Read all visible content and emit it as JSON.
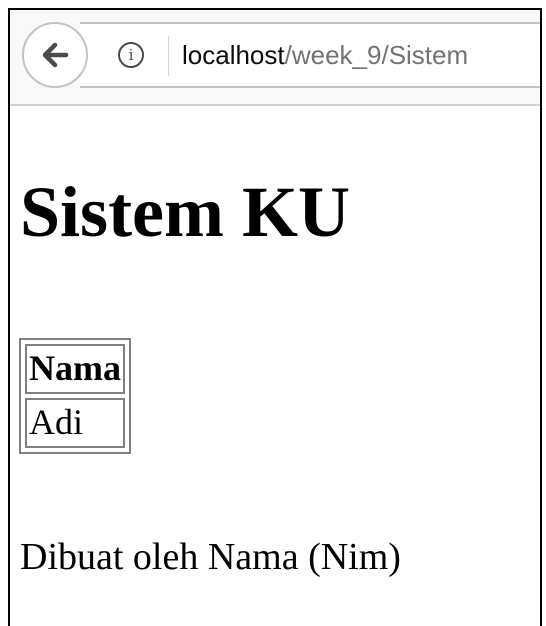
{
  "browser": {
    "back_icon": "arrow-left-icon",
    "info_icon": "info-circle-icon",
    "info_glyph": "i",
    "url_host": "localhost",
    "url_path": "/week_9/Sistem"
  },
  "page": {
    "title": "Sistem KU",
    "table": {
      "header": "Nama",
      "rows": [
        "Adi"
      ]
    },
    "footer": "Dibuat oleh Nama (Nim)"
  }
}
